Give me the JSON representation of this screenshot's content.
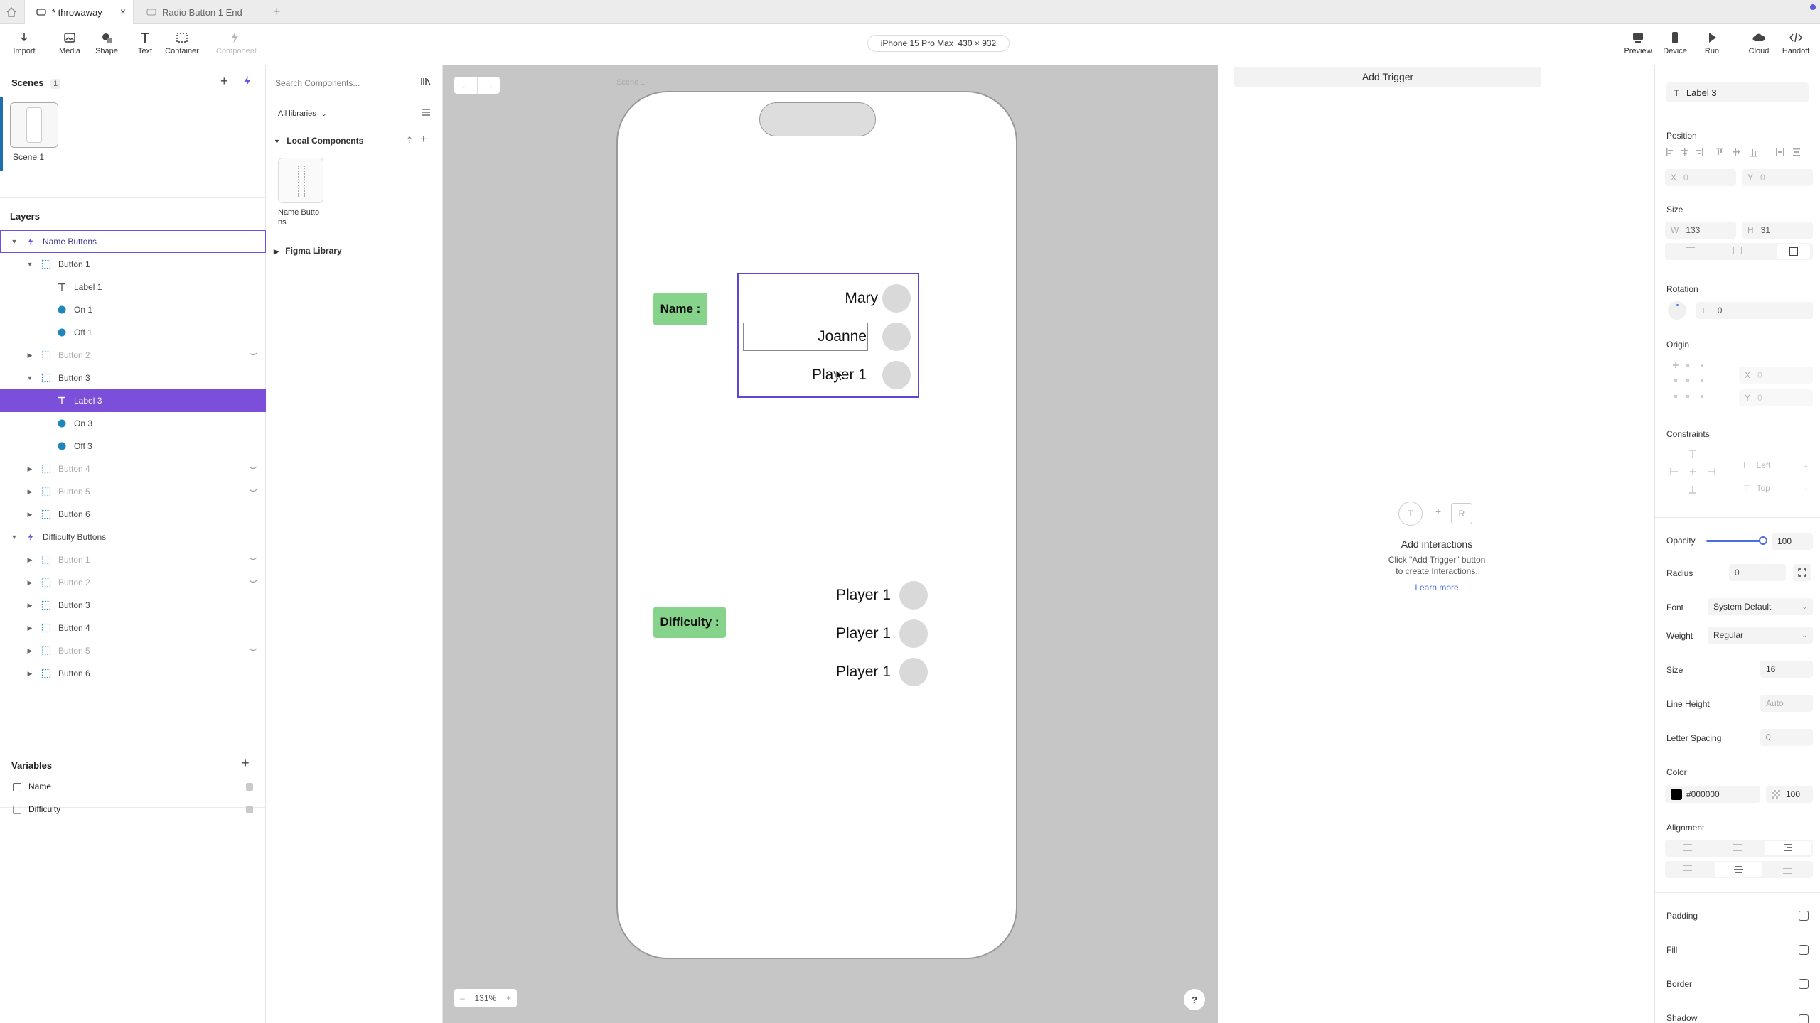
{
  "tabs": [
    {
      "label": "* throwaway",
      "active": true
    },
    {
      "label": "Radio Button 1 End",
      "active": false
    }
  ],
  "toolbar": {
    "left_tools": [
      "Import",
      "Media",
      "Shape",
      "Text",
      "Container",
      "Component"
    ],
    "device_label": "iPhone 15 Pro Max  430 × 932",
    "right_tools": [
      "Preview",
      "Device",
      "Run",
      "Cloud",
      "Handoff"
    ]
  },
  "scenes": {
    "title": "Scenes",
    "count": "1",
    "items": [
      {
        "label": "Scene 1"
      }
    ]
  },
  "layers": {
    "title": "Layers",
    "rows": [
      {
        "label": "Name Buttons",
        "type": "component",
        "depth": 0,
        "expanded": true,
        "state": "outlined",
        "hidden": false
      },
      {
        "label": "Button 1",
        "type": "frame",
        "depth": 1,
        "expanded": true,
        "state": "normal",
        "hidden": false
      },
      {
        "label": "Label 1",
        "type": "text",
        "depth": 2,
        "expanded": null,
        "state": "normal",
        "hidden": false
      },
      {
        "label": "On 1",
        "type": "circle",
        "depth": 2,
        "expanded": null,
        "state": "normal",
        "hidden": false
      },
      {
        "label": "Off 1",
        "type": "circle",
        "depth": 2,
        "expanded": null,
        "state": "normal",
        "hidden": false
      },
      {
        "label": "Button 2",
        "type": "frame",
        "depth": 1,
        "expanded": false,
        "state": "dim",
        "hidden": true
      },
      {
        "label": "Button 3",
        "type": "frame",
        "depth": 1,
        "expanded": true,
        "state": "normal",
        "hidden": false
      },
      {
        "label": "Label 3",
        "type": "text",
        "depth": 2,
        "expanded": null,
        "state": "selected",
        "hidden": false
      },
      {
        "label": "On 3",
        "type": "circle",
        "depth": 2,
        "expanded": null,
        "state": "normal",
        "hidden": false
      },
      {
        "label": "Off 3",
        "type": "circle",
        "depth": 2,
        "expanded": null,
        "state": "normal",
        "hidden": false
      },
      {
        "label": "Button 4",
        "type": "frame",
        "depth": 1,
        "expanded": false,
        "state": "dim",
        "hidden": true
      },
      {
        "label": "Button 5",
        "type": "frame",
        "depth": 1,
        "expanded": false,
        "state": "dim",
        "hidden": true
      },
      {
        "label": "Button 6",
        "type": "frame",
        "depth": 1,
        "expanded": false,
        "state": "normal",
        "hidden": false
      },
      {
        "label": "Difficulty Buttons",
        "type": "component",
        "depth": 0,
        "expanded": true,
        "state": "normal",
        "hidden": false
      },
      {
        "label": "Button 1",
        "type": "frame",
        "depth": 1,
        "expanded": false,
        "state": "dim",
        "hidden": true
      },
      {
        "label": "Button 2",
        "type": "frame",
        "depth": 1,
        "expanded": false,
        "state": "dim",
        "hidden": true
      },
      {
        "label": "Button 3",
        "type": "frame",
        "depth": 1,
        "expanded": false,
        "state": "normal",
        "hidden": false
      },
      {
        "label": "Button 4",
        "type": "frame",
        "depth": 1,
        "expanded": false,
        "state": "normal",
        "hidden": false
      },
      {
        "label": "Button 5",
        "type": "frame",
        "depth": 1,
        "expanded": false,
        "state": "dim",
        "hidden": true
      },
      {
        "label": "Button 6",
        "type": "frame",
        "depth": 1,
        "expanded": false,
        "state": "normal",
        "hidden": false
      }
    ]
  },
  "variables": {
    "title": "Variables",
    "items": [
      {
        "label": "Name"
      },
      {
        "label": "Difficulty"
      }
    ]
  },
  "components": {
    "search_placeholder": "Search Components...",
    "library_filter": "All libraries",
    "local_title": "Local Components",
    "local_items": [
      {
        "label": "Name Butto\nns"
      }
    ],
    "figma_title": "Figma Library"
  },
  "canvas": {
    "scene_label": "Scene 1",
    "zoom": "131%",
    "name_label": "Name :",
    "difficulty_label": "Difficulty :",
    "name_options": [
      "Mary",
      "Joanne",
      "Player 1"
    ],
    "difficulty_options": [
      "Player 1",
      "Player 1",
      "Player 1"
    ],
    "help": "?"
  },
  "interactions": {
    "add_trigger": "Add Trigger",
    "trigger_letter": "T",
    "plus": "+",
    "response_letter": "R",
    "title": "Add interactions",
    "hint": "Click \"Add Trigger\" button\nto create Interactions.",
    "learn_more": "Learn more"
  },
  "properties": {
    "selected_name": "Label 3",
    "position": {
      "title": "Position",
      "x_label": "X",
      "x": "0",
      "y_label": "Y",
      "y": "0"
    },
    "size": {
      "title": "Size",
      "w_label": "W",
      "w": "133",
      "h_label": "H",
      "h": "31"
    },
    "rotation": {
      "title": "Rotation",
      "value": "0"
    },
    "origin": {
      "title": "Origin",
      "x_label": "X",
      "x": "0",
      "y_label": "Y",
      "y": "0"
    },
    "constraints": {
      "title": "Constraints",
      "horizontal": "Left",
      "vertical": "Top"
    },
    "opacity": {
      "title": "Opacity",
      "value": "100",
      "level": 100
    },
    "radius": {
      "title": "Radius",
      "value": "0"
    },
    "font": {
      "title": "Font",
      "value": "System Default"
    },
    "weight": {
      "title": "Weight",
      "value": "Regular"
    },
    "font_size": {
      "title": "Size",
      "value": "16"
    },
    "line_height": {
      "title": "Line Height",
      "value": "Auto"
    },
    "letter_spacing": {
      "title": "Letter Spacing",
      "value": "0"
    },
    "color": {
      "title": "Color",
      "hex": "#000000",
      "opacity": "100",
      "swatch": "#000000"
    },
    "alignment": {
      "title": "Alignment",
      "horizontal": "right",
      "vertical": "middle"
    },
    "toggles": [
      {
        "label": "Padding"
      },
      {
        "label": "Fill"
      },
      {
        "label": "Border"
      },
      {
        "label": "Shadow"
      }
    ]
  },
  "colors": {
    "accent": "#7b4fd9",
    "selection_outline": "#6f4fe0",
    "label_chip": "#86d48c",
    "canvas_bg": "#c6c6c6",
    "radio_off": "#d9d9d9",
    "variable_badge": "#e05050"
  }
}
